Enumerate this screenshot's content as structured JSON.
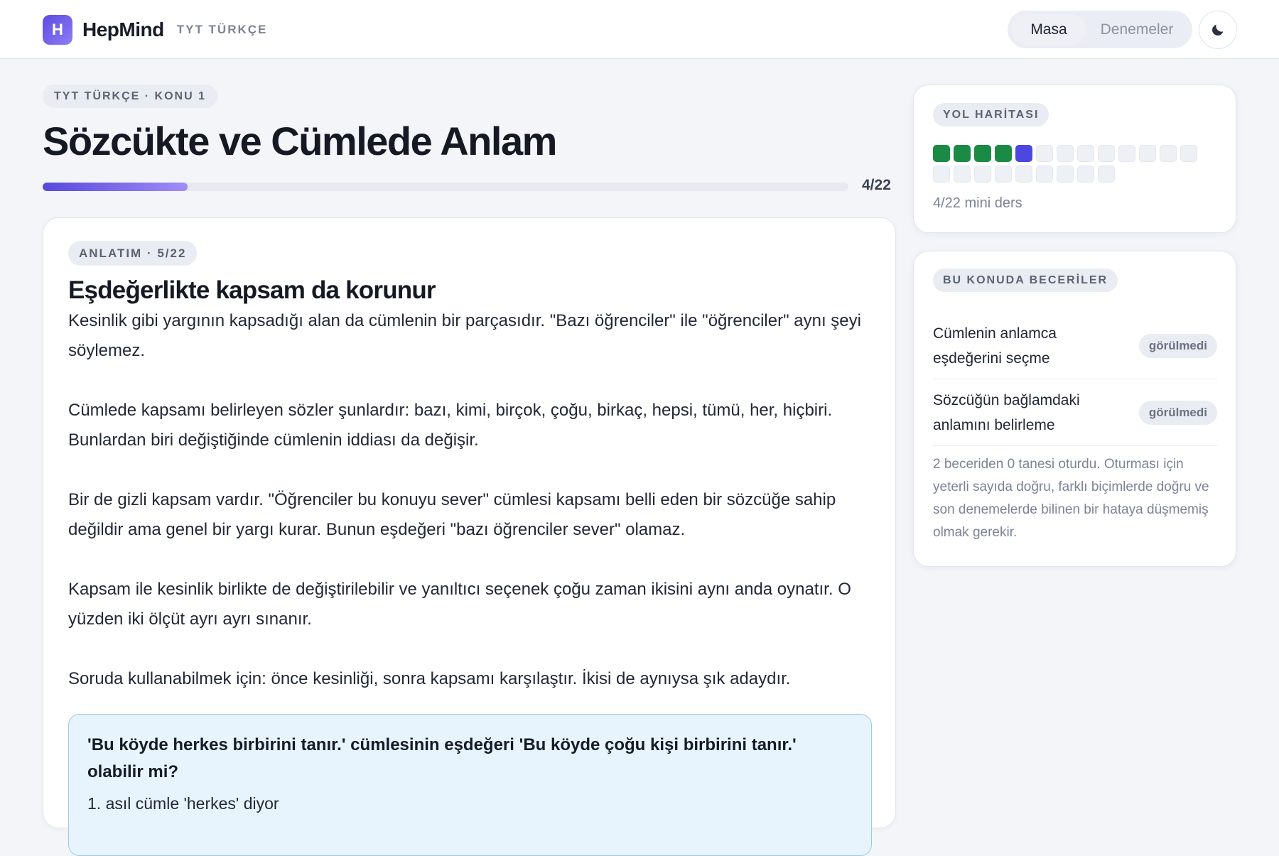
{
  "header": {
    "logo_letter": "H",
    "app_name": "HepMind",
    "subject": "TYT TÜRKÇE",
    "nav": {
      "active": "Masa",
      "inactive": "Denemeler"
    },
    "theme_icon": "moon-icon"
  },
  "topic": {
    "breadcrumb": "TYT TÜRKÇE · KONU 1",
    "title": "Sözcükte ve Cümlede Anlam",
    "progress_label": "4/22",
    "progress_fraction": 0.18
  },
  "lesson": {
    "section_label": "ANLATIM · 5/22",
    "heading": "Eşdeğerlikte kapsam da korunur",
    "paragraphs": [
      "Kesinlik gibi yargının kapsadığı alan da cümlenin bir parçasıdır. \"Bazı öğrenciler\" ile \"öğrenciler\" aynı şeyi söylemez.",
      "Cümlede kapsamı belirleyen sözler şunlardır: bazı, kimi, birçok, çoğu, birkaç, hepsi, tümü, her, hiçbiri. Bunlardan biri değiştiğinde cümlenin iddiası da değişir.",
      "Bir de gizli kapsam vardır. \"Öğrenciler bu konuyu sever\" cümlesi kapsamı belli eden bir sözcüğe sahip değildir ama genel bir yargı kurar. Bunun eşdeğeri \"bazı öğrenciler sever\" olamaz.",
      "Kapsam ile kesinlik birlikte de değiştirilebilir ve yanıltıcı seçenek çoğu zaman ikisini aynı anda oynatır. O yüzden iki ölçüt ayrı ayrı sınanır.",
      "Soruda kullanabilmek için: önce kesinliği, sonra kapsamı karşılaştır. İkisi de aynıysa şık adaydır."
    ],
    "callout": {
      "question": "'Bu köyde herkes birbirini tanır.' cümlesinin eşdeğeri 'Bu köyde çoğu kişi birbirini tanır.' olabilir mi?",
      "step_1": "1. asıl cümle 'herkes' diyor"
    }
  },
  "roadmap": {
    "label": "YOL HARİTASI",
    "total": 22,
    "done": 4,
    "current_index": 4,
    "caption": "4/22 mini ders",
    "colors": {
      "done": "#1b8a45",
      "current": "#4b47e0",
      "pending": "#edf0f5"
    }
  },
  "skills": {
    "label": "BU KONUDA BECERİLER",
    "items": [
      {
        "label": "Cümlenin anlamca eşdeğerini seçme",
        "status": "görülmedi"
      },
      {
        "label": "Sözcüğün bağlamdaki anlamını belirleme",
        "status": "görülmedi"
      }
    ],
    "note": "2 beceriden 0 tanesi oturdu. Oturması için yeterli sayıda doğru, farklı biçimlerde doğru ve son denemelerde bilinen bir hataya düşmemiş olmak gerekir."
  }
}
